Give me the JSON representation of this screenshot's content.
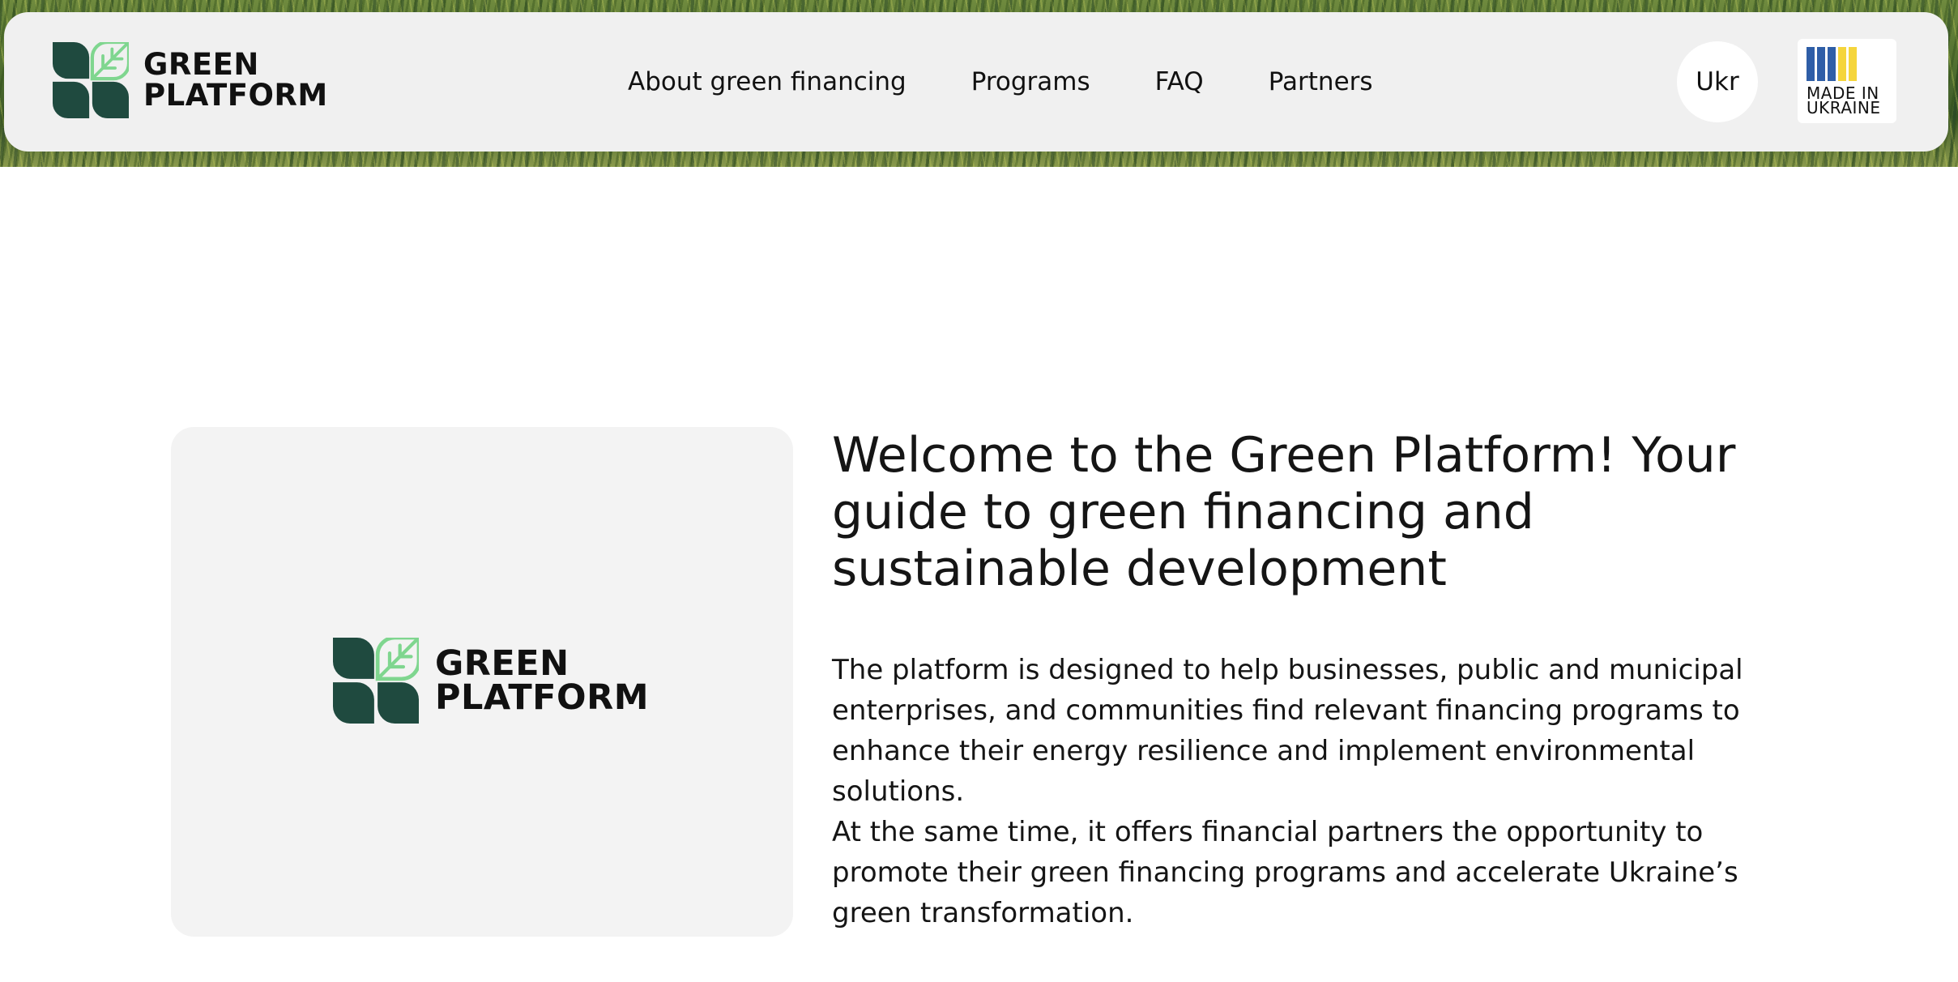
{
  "header": {
    "logo": {
      "line1": "GREEN",
      "line2": "PLATFORM"
    },
    "nav": [
      {
        "label": "About green financing"
      },
      {
        "label": "Programs"
      },
      {
        "label": "FAQ"
      },
      {
        "label": "Partners"
      }
    ],
    "language_button": "Ukr",
    "badge": {
      "line1": "MADE IN",
      "line2": "UKRAINE",
      "bar_colors": [
        "#2f5ea7",
        "#2f5ea7",
        "#2f5ea7",
        "#f5d53c",
        "#f5d53c"
      ]
    }
  },
  "intro": {
    "image_logo": {
      "line1": "GREEN",
      "line2": "PLATFORM"
    },
    "title": "Welcome to the Green Platform! Your guide to green financing and sustainable development",
    "paragraphs": [
      "The platform is designed to help businesses, public and municipal enterprises, and communities find relevant financing programs to enhance their energy resilience and implement environmental solutions.",
      "At the same time, it offers financial partners the opportunity to promote their green financing programs and accelerate Ukraine’s green transformation."
    ]
  },
  "colors": {
    "logo_dark": "#1f4a3f",
    "logo_leaf": "#7fd68f",
    "header_bg": "#f0f0f0",
    "card_bg": "#f3f3f3"
  },
  "icons": [
    "green-platform-logo-icon",
    "made-in-ukraine-badge-icon"
  ]
}
